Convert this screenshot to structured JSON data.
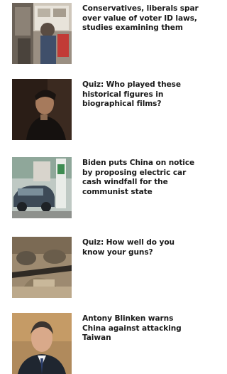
{
  "feed": {
    "items": [
      {
        "headline": "Conservatives, liberals spar\nover value of voter ID laws,\nstudies examining them",
        "image": "voting-booth-photo"
      },
      {
        "headline": "Quiz: Who played these\nhistorical figures in\nbiographical films?",
        "image": "film-actor-portrait-photo"
      },
      {
        "headline": "Biden puts China on notice\nby proposing electric car\ncash windfall for the\ncommunist state",
        "image": "electric-car-charging-photo"
      },
      {
        "headline": "Quiz: How well do you\nknow your guns?",
        "image": "soldiers-with-guns-photo"
      },
      {
        "headline": "Antony Blinken warns\nChina against attacking\nTaiwan",
        "image": "antony-blinken-portrait-photo"
      }
    ]
  }
}
